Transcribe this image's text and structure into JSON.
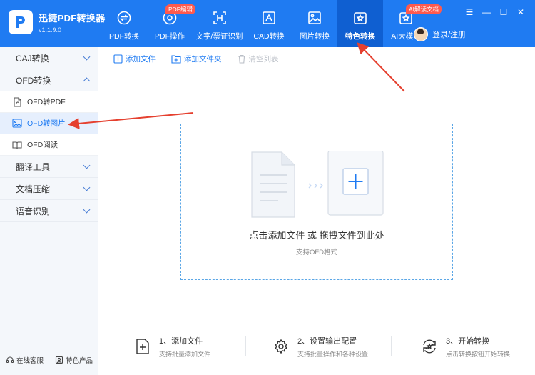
{
  "app": {
    "name": "迅捷PDF转换器",
    "version": "v1.1.9.0"
  },
  "nav": [
    {
      "label": "PDF转换",
      "icon": "pdf-convert-icon",
      "badge": ""
    },
    {
      "label": "PDF操作",
      "icon": "pdf-operate-icon",
      "badge": "PDF编辑"
    },
    {
      "label": "文字/票证识别",
      "icon": "ocr-icon",
      "badge": ""
    },
    {
      "label": "CAD转换",
      "icon": "cad-icon",
      "badge": ""
    },
    {
      "label": "图片转换",
      "icon": "image-icon",
      "badge": ""
    },
    {
      "label": "特色转换",
      "icon": "special-convert-icon",
      "badge": "",
      "active": true
    },
    {
      "label": "AI大模型",
      "icon": "ai-model-icon",
      "badge": "AI解读文档"
    }
  ],
  "login_label": "登录/注册",
  "sidebar": {
    "groups": [
      {
        "label": "CAJ转换",
        "expanded": false
      },
      {
        "label": "OFD转换",
        "expanded": true,
        "items": [
          {
            "label": "OFD转PDF",
            "icon": "pdf-file-icon"
          },
          {
            "label": "OFD转图片",
            "icon": "image-file-icon",
            "active": true
          },
          {
            "label": "OFD阅读",
            "icon": "book-icon"
          }
        ]
      },
      {
        "label": "翻译工具",
        "expanded": false
      },
      {
        "label": "文档压缩",
        "expanded": false
      },
      {
        "label": "语音识别",
        "expanded": false
      }
    ],
    "footer": {
      "service": "在线客服",
      "products": "特色产品"
    }
  },
  "toolbar": {
    "add_file": "添加文件",
    "add_folder": "添加文件夹",
    "clear_list": "清空列表"
  },
  "dropzone": {
    "title": "点击添加文件 或 拖拽文件到此处",
    "subtitle": "支持OFD格式"
  },
  "steps": [
    {
      "title": "1、添加文件",
      "desc": "支持批量添加文件"
    },
    {
      "title": "2、设置输出配置",
      "desc": "支持批量操作和各种设置"
    },
    {
      "title": "3、开始转换",
      "desc": "点击转换按钮开始转换"
    }
  ],
  "colors": {
    "primary": "#1f7bf2",
    "active_nav": "#0f5fd1",
    "badge": "#ff5a4e",
    "annotation_arrow": "#e5402f"
  }
}
